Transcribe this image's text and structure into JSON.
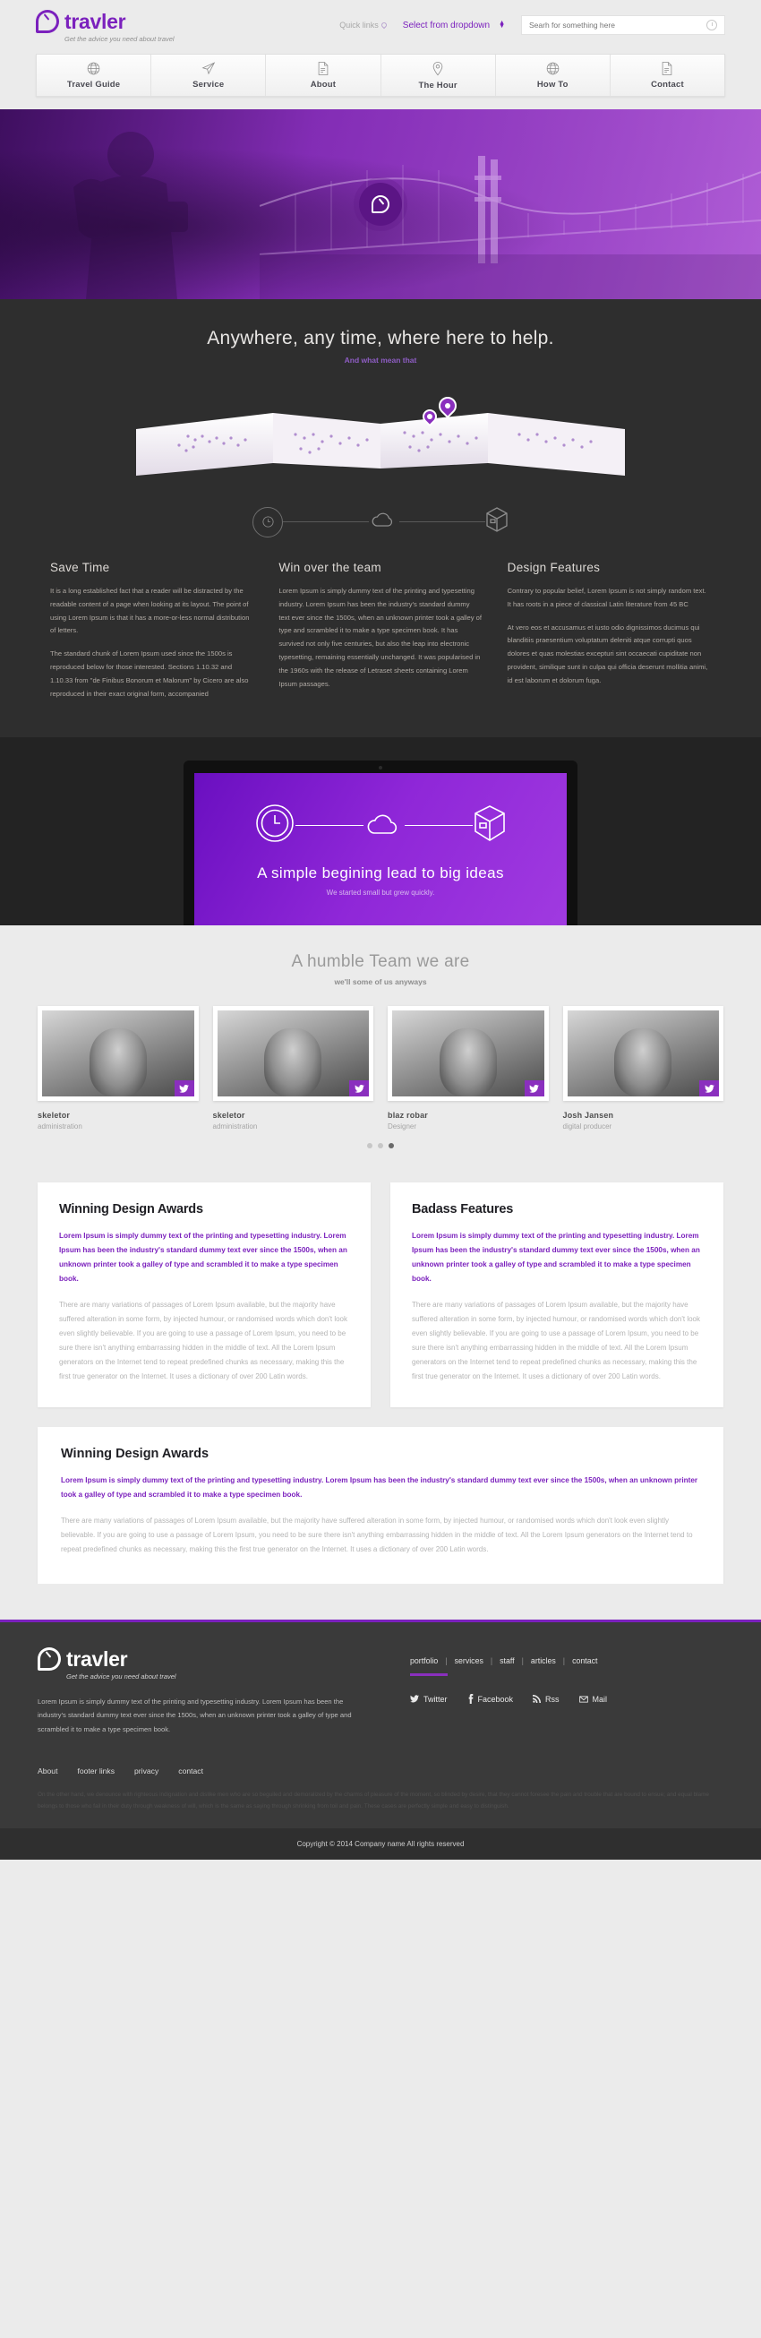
{
  "brand": {
    "name": "travler",
    "tagline": "Get the advice you need about travel"
  },
  "topbar": {
    "quick_links": "Quick links",
    "quick_links_icon": "pin-icon",
    "dropdown_value": "Select from dropdown",
    "search_placeholder": "Searh for something here",
    "search_value": "",
    "search_icon": "clock-search-icon"
  },
  "nav": {
    "items": [
      {
        "label": "Travel Guide",
        "icon": "globe-icon"
      },
      {
        "label": "Service",
        "icon": "paper-plane-icon"
      },
      {
        "label": "About",
        "icon": "document-icon"
      },
      {
        "label": "The Hour",
        "icon": "map-pin-icon"
      },
      {
        "label": "How To",
        "icon": "globe-icon"
      },
      {
        "label": "Contact",
        "icon": "document-icon"
      }
    ]
  },
  "hero": {
    "badge_icon": "travler-logo-icon",
    "image_alt": "traveler with backpack and suspension bridge"
  },
  "intro": {
    "heading": "Anywhere, any time, where here to help.",
    "subheading": "And what mean that",
    "map_alt": "folded world map with location markers",
    "icons": [
      "clock-icon",
      "cloud-icon",
      "box-icon"
    ]
  },
  "features": [
    {
      "title": "Save Time",
      "paragraphs": [
        "It is a long established fact that a reader will be distracted by the readable content of a page when looking at its layout. The point of using Lorem Ipsum is that it has a more-or-less normal distribution of letters.",
        "The standard chunk of Lorem Ipsum used since the 1500s is reproduced below for those interested. Sections 1.10.32 and 1.10.33 from \"de Finibus Bonorum et Malorum\" by Cicero are also reproduced in their exact original form, accompanied"
      ]
    },
    {
      "title": "Win over the team",
      "paragraphs": [
        "Lorem Ipsum is simply dummy text of the printing and typesetting industry. Lorem Ipsum has been the industry's standard dummy text ever since the 1500s, when an unknown printer took a galley of type and scrambled it to make a type specimen book. It has survived not only five centuries, but also the leap into electronic typesetting, remaining essentially unchanged. It was popularised in the 1960s with the release of Letraset sheets containing Lorem Ipsum passages."
      ]
    },
    {
      "title": "Design Features",
      "paragraphs": [
        "Contrary to popular belief, Lorem Ipsum is not simply random text. It has roots in a piece of classical Latin literature from 45 BC",
        "At vero eos et accusamus et iusto odio dignissimos ducimus qui blanditiis praesentium voluptatum deleniti atque corrupti quos dolores et quas molestias excepturi sint occaecati cupiditate non provident, similique sunt in culpa qui officia deserunt mollitia animi, id est laborum et dolorum fuga."
      ]
    }
  ],
  "showcase": {
    "heading": "A simple begining lead to big ideas",
    "subheading": "We started small but grew quickly.",
    "icons": [
      "clock-icon",
      "cloud-icon",
      "box-icon"
    ]
  },
  "team": {
    "heading": "A humble Team we are",
    "subheading": "we'll some of us anyways",
    "members": [
      {
        "name": "skeletor",
        "role": "administration",
        "social_icon": "twitter-icon"
      },
      {
        "name": "skeletor",
        "role": "administration",
        "social_icon": "twitter-icon"
      },
      {
        "name": "blaz robar",
        "role": "Designer",
        "social_icon": "twitter-icon"
      },
      {
        "name": "Josh Jansen",
        "role": "digital producer",
        "social_icon": "twitter-icon"
      }
    ],
    "carousel_dots": 3,
    "carousel_active": 3
  },
  "cards": [
    {
      "title": "Winning Design Awards",
      "lead": "Lorem Ipsum is simply dummy text of the printing and typesetting industry. Lorem Ipsum has been the industry's standard dummy text ever since the 1500s, when an unknown printer took a galley of type and scrambled it to make a type specimen book.",
      "body": "There are many variations of passages of Lorem Ipsum available, but the majority have suffered alteration in some form, by injected humour, or randomised words which don't look even slightly believable. If you are going to use a passage of Lorem Ipsum, you need to be sure there isn't anything embarrassing hidden in the middle of text. All the Lorem Ipsum generators on the Internet tend to repeat predefined chunks as necessary, making this the first true generator on the Internet. It uses a dictionary of over 200 Latin words."
    },
    {
      "title": "Badass Features",
      "lead": "Lorem Ipsum is simply dummy text of the printing and typesetting industry. Lorem Ipsum has been the industry's standard dummy text ever since the 1500s, when an unknown printer took a galley of type and scrambled it to make a type specimen book.",
      "body": "There are many variations of passages of Lorem Ipsum available, but the majority have suffered alteration in some form, by injected humour, or randomised words which don't look even slightly believable. If you are going to use a passage of Lorem Ipsum, you need to be sure there isn't anything embarrassing hidden in the middle of text. All the Lorem Ipsum generators on the Internet tend to repeat predefined chunks as necessary, making this the first true generator on the Internet. It uses a dictionary of over 200 Latin words."
    }
  ],
  "wide_card": {
    "title": "Winning Design Awards",
    "lead": "Lorem Ipsum is simply dummy text of the printing and typesetting industry. Lorem Ipsum has been the industry's standard dummy text ever since the 1500s, when an unknown printer took a galley of type and scrambled it to make a type specimen book.",
    "body": "There are many variations of passages of Lorem Ipsum available, but the majority have suffered alteration in some form, by injected humour, or randomised words which don't look even slightly believable. If you are going to use a passage of Lorem Ipsum, you need to be sure there isn't anything embarrassing hidden in the middle of text. All the Lorem Ipsum generators on the Internet tend to repeat predefined chunks as necessary, making this the first true generator on the Internet. It uses a dictionary of over 200 Latin words."
  },
  "footer": {
    "description": "Lorem Ipsum is simply dummy text of the printing and typesetting industry. Lorem Ipsum has been the industry's standard dummy text ever since the 1500s, when an unknown printer took a galley of type and scrambled it to make a type specimen book.",
    "links": [
      "portfolio",
      "services",
      "staff",
      "articles",
      "contact"
    ],
    "socials": [
      {
        "label": "Twitter",
        "icon": "twitter-icon"
      },
      {
        "label": "Facebook",
        "icon": "facebook-icon"
      },
      {
        "label": "Rss",
        "icon": "rss-icon"
      },
      {
        "label": "Mail",
        "icon": "mail-icon"
      }
    ],
    "nav": [
      "About",
      "footer links",
      "privacy",
      "contact"
    ],
    "legal": "On the other hand, we denounce with righteous indignation and dislike men who are so beguiled and demoralized by the charms of pleasure of the moment, so blinded by desire, that they cannot foresee the pain and trouble that are bound to ensue; and equal blame belongs to those who fail in their duty through weakness of will, which is the same as saying through shrinking from toil and pain. These cases are perfectly simple and easy to distinguish.",
    "copyright": "Copyright © 2014 Company name All rights reserved"
  },
  "colors": {
    "accent": "#7b21bd",
    "accent_bright": "#8a2fbe",
    "dark": "#2e2e2e",
    "footer": "#3a3a3a",
    "page_bg": "#ebebeb"
  }
}
